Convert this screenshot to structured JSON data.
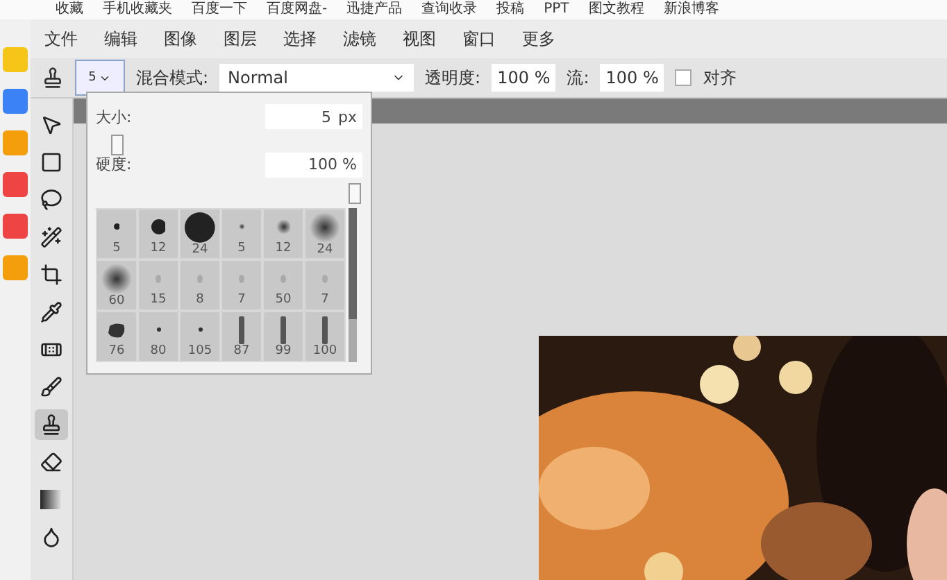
{
  "bookmarks": [
    "收藏",
    "手机收藏夹",
    "百度一下",
    "百度网盘-",
    "迅捷产品",
    "查询收录",
    "投稿",
    "PPT",
    "图文教程",
    "新浪博客"
  ],
  "menu": [
    "文件",
    "编辑",
    "图像",
    "图层",
    "选择",
    "滤镜",
    "视图",
    "窗口",
    "更多"
  ],
  "options": {
    "brush_size": "5",
    "blend_label": "混合模式:",
    "blend_value": "Normal",
    "opacity_label": "透明度:",
    "opacity_value": "100 %",
    "flow_label": "流:",
    "flow_value": "100 %",
    "align_label": "对齐",
    "align_checked": false
  },
  "tools": [
    {
      "kind": "move",
      "selected": false
    },
    {
      "kind": "marquee",
      "selected": false
    },
    {
      "kind": "lasso",
      "selected": false
    },
    {
      "kind": "wand",
      "selected": false
    },
    {
      "kind": "crop",
      "selected": false
    },
    {
      "kind": "dropper",
      "selected": false
    },
    {
      "kind": "heal",
      "selected": false
    },
    {
      "kind": "brush",
      "selected": false
    },
    {
      "kind": "stamp",
      "selected": true
    },
    {
      "kind": "eraser",
      "selected": false
    },
    {
      "kind": "gradient",
      "selected": false
    },
    {
      "kind": "drop",
      "selected": false
    }
  ],
  "brush_popup": {
    "size_label": "大小:",
    "size_value": "5",
    "size_unit": "px",
    "size_slider": {
      "level": 0.05
    },
    "hardness_label": "硬度:",
    "hardness_value": "100 %",
    "hardness_slider": {
      "level": 1
    },
    "brushes": [
      {
        "kind": "hard",
        "label": "5",
        "selected": false
      },
      {
        "kind": "hard",
        "label": "12",
        "selected": false
      },
      {
        "kind": "hard",
        "label": "24",
        "selected": false
      },
      {
        "kind": "soft",
        "label": "5",
        "selected": false
      },
      {
        "kind": "soft",
        "label": "12",
        "selected": false
      },
      {
        "kind": "soft",
        "label": "24",
        "selected": false
      },
      {
        "kind": "soft",
        "label": "60",
        "selected": false
      },
      {
        "kind": "faint",
        "label": "15",
        "selected": false
      },
      {
        "kind": "faint",
        "label": "8",
        "selected": false
      },
      {
        "kind": "faint",
        "label": "7",
        "selected": false
      },
      {
        "kind": "faint",
        "label": "50",
        "selected": false
      },
      {
        "kind": "faint",
        "label": "7",
        "selected": false
      },
      {
        "kind": "blob",
        "label": "76",
        "selected": false
      },
      {
        "kind": "dot",
        "label": "80",
        "selected": false
      },
      {
        "kind": "dot",
        "label": "105",
        "selected": false
      },
      {
        "kind": "stroke",
        "label": "87",
        "selected": false
      },
      {
        "kind": "stroke",
        "label": "99",
        "selected": false
      },
      {
        "kind": "stroke",
        "label": "100",
        "selected": false
      }
    ]
  },
  "canvas": {
    "kind": "picture"
  }
}
